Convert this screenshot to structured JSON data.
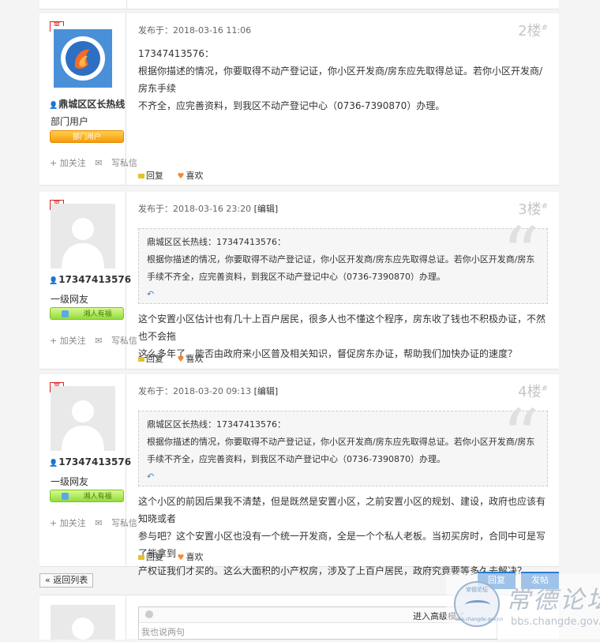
{
  "topstrip": {
    "ghost_text": "回复    喜欢"
  },
  "posts": [
    {
      "online_label": "离线",
      "username": "鼎城区区长热线",
      "group": "部门用户",
      "medal_label": "部门用户",
      "follow_label": "+ 加关注",
      "message_label": "写私信",
      "meta": "发布于：2018-03-16 11:06",
      "edit_label": "",
      "floor": "2楼",
      "body_lines": [
        "17347413576：",
        "根据你描述的情况，你要取得不动产登记证，你小区开发商/房东应先取得总证。若你小区开发商/房东手续",
        "不齐全，应完善资料，到我区不动产登记中心（0736-7390870）办理。"
      ],
      "reply_label": "回复",
      "like_label": "喜欢"
    },
    {
      "online_label": "离线",
      "username": "17347413576",
      "group": "一级网友",
      "medal_label": "湘人有福",
      "follow_label": "+ 加关注",
      "message_label": "写私信",
      "meta": "发布于：2018-03-16 23:20",
      "edit_label": "[编辑]",
      "floor": "3楼",
      "quote_lines": [
        "鼎城区区长热线：17347413576：",
        "根据你描述的情况，你要取得不动产登记证，你小区开发商/房东应先取得总证。若你小区开发商/房东",
        "手续不齐全，应完善资料，到我区不动产登记中心（0736-7390870）办理。"
      ],
      "body_lines": [
        "这个安置小区估计也有几十上百户居民，很多人也不懂这个程序，房东收了钱也不积极办证，不然也不会拖",
        "这么多年了。能否由政府来小区普及相关知识，督促房东办证，帮助我们加快办证的速度？"
      ],
      "reply_label": "回复",
      "like_label": "喜欢"
    },
    {
      "online_label": "离线",
      "username": "17347413576",
      "group": "一级网友",
      "medal_label": "湘人有福",
      "follow_label": "+ 加关注",
      "message_label": "写私信",
      "meta": "发布于：2018-03-20 09:13",
      "edit_label": "[编辑]",
      "floor": "4楼",
      "quote_lines": [
        "鼎城区区长热线：17347413576：",
        "根据你描述的情况，你要取得不动产登记证，你小区开发商/房东应先取得总证。若你小区开发商/房东",
        "手续不齐全，应完善资料，到我区不动产登记中心（0736-7390870）办理。"
      ],
      "body_lines": [
        "这个小区的前因后果我不清楚，但是既然是安置小区，之前安置小区的规划、建设，政府也应该有知晓或者",
        "参与吧？这个安置小区也没有一个统一开发商，全是一个个私人老板。当初买房时，合同中可是写了能拿到",
        "产权证我们才买的。这么大面积的小产权房，涉及了上百户居民，政府究竟要等多久去解决？"
      ],
      "reply_label": "回复",
      "like_label": "喜欢"
    }
  ],
  "footer": {
    "back_label": "« 返回列表",
    "reply_button": "回复",
    "post_button": "发帖"
  },
  "reply_box": {
    "advanced_mode": "进入高级模式",
    "placeholder": "我也说两句"
  },
  "watermark": {
    "title": "常德论坛",
    "url": "bbs.changde.gov.cn",
    "circle_top": "常德论坛",
    "circle_bottom": "bbs.changde.gov.cn"
  }
}
